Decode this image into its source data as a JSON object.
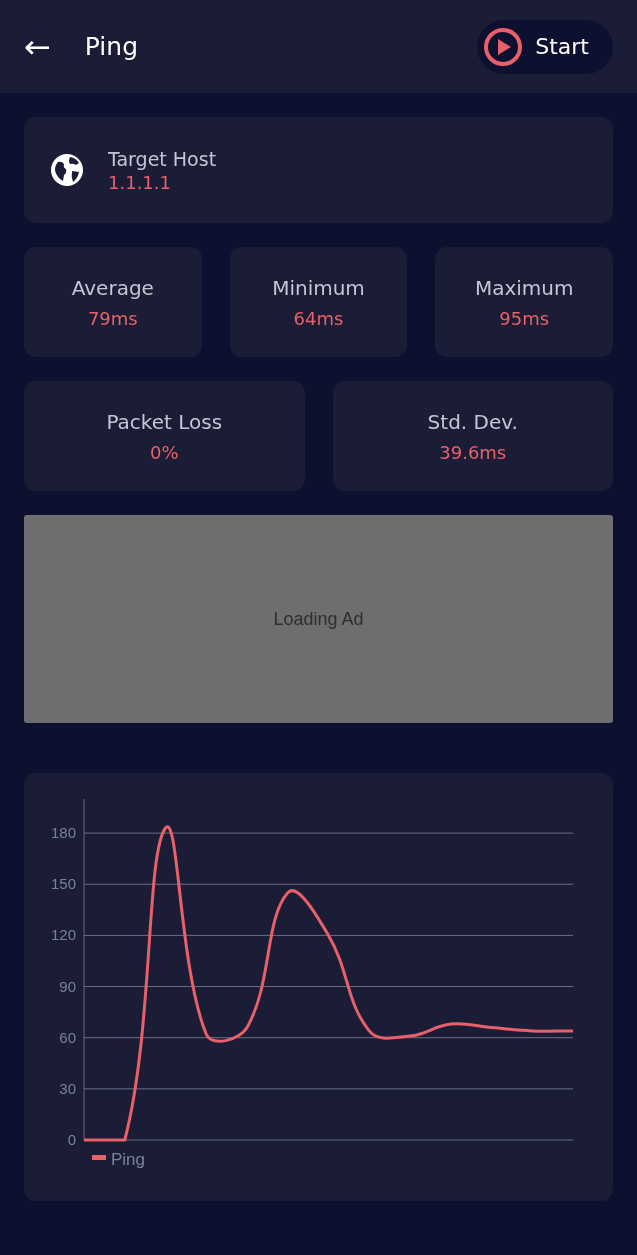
{
  "header": {
    "back": "←",
    "title": "Ping",
    "start_button": "Start"
  },
  "target": {
    "label": "Target Host",
    "value": "1.1.1.1"
  },
  "stats_row_1": [
    {
      "label": "Average",
      "value": "79ms"
    },
    {
      "label": "Minimum",
      "value": "64ms"
    },
    {
      "label": "Maximum",
      "value": "95ms"
    }
  ],
  "stats_row_2": [
    {
      "label": "Packet Loss",
      "value": "0%"
    },
    {
      "label": "Std. Dev.",
      "value": "39.6ms"
    }
  ],
  "ad": {
    "text": "Loading Ad"
  },
  "chart": {
    "chart_data": {
      "type": "line",
      "grid": true,
      "ylim": [
        0,
        200
      ],
      "yticks": [
        0,
        30,
        60,
        90,
        120,
        150,
        180
      ],
      "series": [
        {
          "name": "Ping",
          "color": "#e8606a",
          "values": [
            0,
            0,
            183,
            62,
            66,
            145,
            120,
            64,
            61,
            68,
            66,
            64,
            64
          ]
        }
      ]
    }
  }
}
